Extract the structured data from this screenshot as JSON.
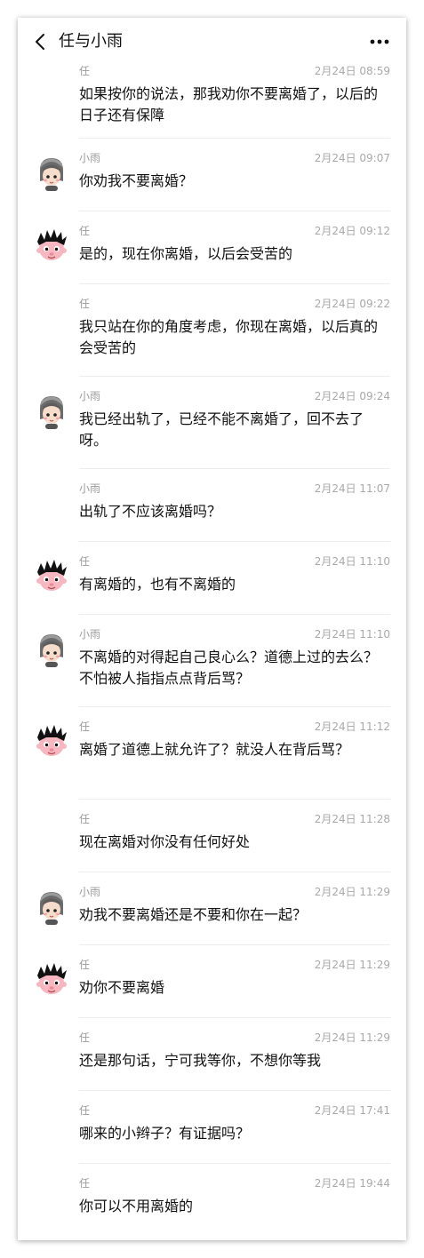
{
  "header": {
    "title": "任与小雨"
  },
  "messages": [
    {
      "sender": "任",
      "avatar": "none",
      "time": "2月24日 08:59",
      "text": "如果按你的说法，那我劝你不要离婚了，以后的日子还有保障"
    },
    {
      "sender": "小雨",
      "avatar": "girl",
      "time": "2月24日 09:07",
      "text": "你劝我不要离婚？"
    },
    {
      "sender": "任",
      "avatar": "boy",
      "time": "2月24日 09:12",
      "text": "是的，现在你离婚，以后会受苦的"
    },
    {
      "sender": "任",
      "avatar": "none",
      "time": "2月24日 09:22",
      "text": "我只站在你的角度考虑，你现在离婚，以后真的会受苦的"
    },
    {
      "sender": "小雨",
      "avatar": "girl",
      "time": "2月24日 09:24",
      "text": "我已经出轨了，已经不能不离婚了，回不去了呀。"
    },
    {
      "sender": "小雨",
      "avatar": "none",
      "time": "2月24日 11:07",
      "text": "出轨了不应该离婚吗？"
    },
    {
      "sender": "任",
      "avatar": "boy",
      "time": "2月24日 11:10",
      "text": "有离婚的，也有不离婚的"
    },
    {
      "sender": "小雨",
      "avatar": "girl",
      "time": "2月24日 11:10",
      "text": "不离婚的对得起自己良心么？道德上过的去么？不怕被人指指点点背后骂？"
    },
    {
      "sender": "任",
      "avatar": "boy",
      "time": "2月24日 11:12",
      "text": "离婚了道德上就允许了？就没人在背后骂？"
    },
    {
      "sender": "任",
      "avatar": "none",
      "time": "2月24日 11:28",
      "text": "现在离婚对你没有任何好处"
    },
    {
      "sender": "小雨",
      "avatar": "girl",
      "time": "2月24日 11:29",
      "text": "劝我不要离婚还是不要和你在一起？"
    },
    {
      "sender": "任",
      "avatar": "boy",
      "time": "2月24日 11:29",
      "text": "劝你不要离婚"
    },
    {
      "sender": "任",
      "avatar": "none",
      "time": "2月24日 11:29",
      "text": "还是那句话，宁可我等你，不想你等我"
    },
    {
      "sender": "任",
      "avatar": "none",
      "time": "2月24日 17:41",
      "text": "哪来的小辫子？有证据吗？"
    },
    {
      "sender": "任",
      "avatar": "none",
      "time": "2月24日 19:44",
      "text": "你可以不用离婚的"
    }
  ]
}
